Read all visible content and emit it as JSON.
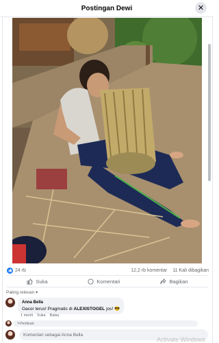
{
  "header": {
    "title": "Postingan Dewi"
  },
  "icons": {
    "close": "close-icon",
    "like": "thumbs-up-icon",
    "comment": "chat-bubble-icon",
    "share": "share-arrow-icon"
  },
  "stats": {
    "reactions": "24 rb",
    "comments": "12,2 rb komentar",
    "shares": "11 Kali dibagikan"
  },
  "actions": {
    "like": "Suka",
    "comment": "Komentari",
    "share": "Bagikan"
  },
  "comments_sort": "Paling relevan",
  "comments": [
    {
      "author": "Anna Bella",
      "text": "Gacor terus! Pragmatic di",
      "highlight": "ALEXISTOGEL",
      "suffix": " jos!",
      "emoji": "😎",
      "time": "1 menit",
      "like_label": "Suka",
      "reply_label": "Balas"
    }
  ],
  "reply_preview": "Pembuat",
  "composer": {
    "placeholder": "Komentari sebagai Anna Bella"
  },
  "watermark": "Activate Windows",
  "colors": {
    "accent": "#1877f2",
    "bubble": "#f0f2f5",
    "muted": "#65676b"
  }
}
